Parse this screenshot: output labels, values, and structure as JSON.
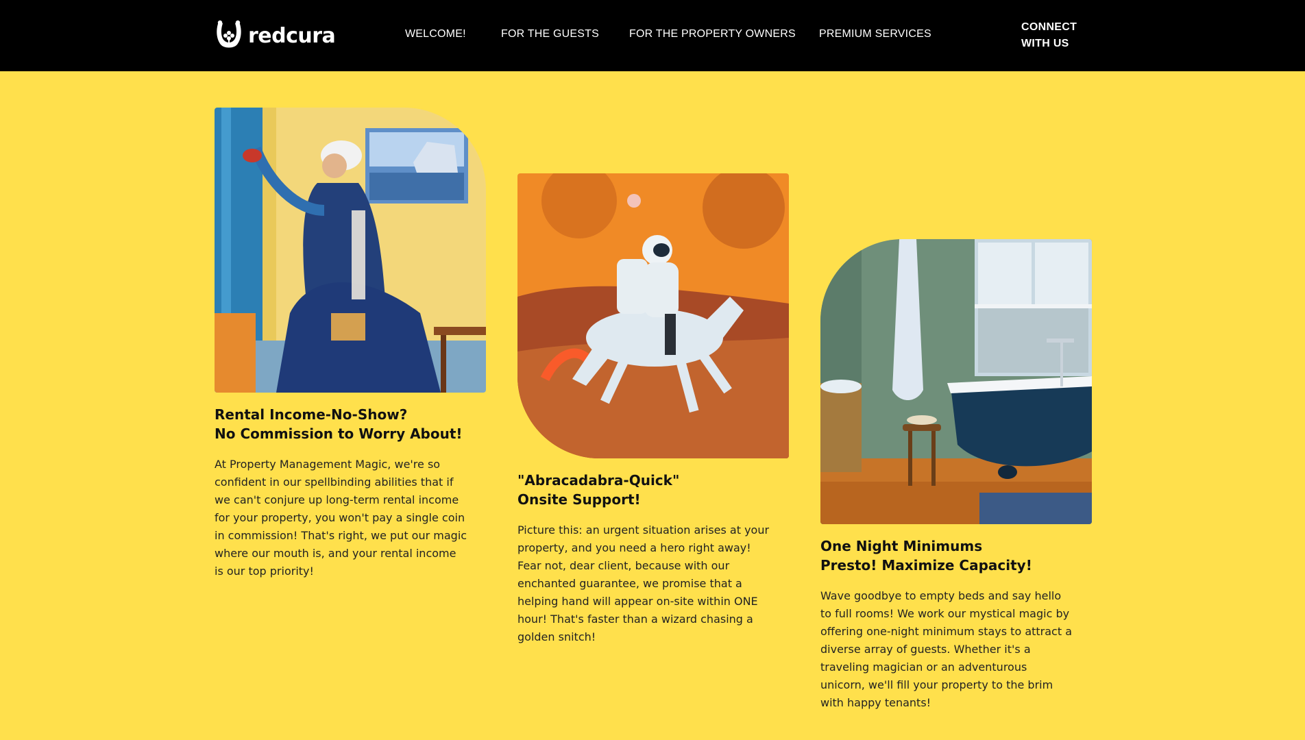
{
  "brand": {
    "name": "redcura",
    "logo_icon": "horseshoe-clover-icon"
  },
  "nav": {
    "items": [
      {
        "label": "WELCOME!"
      },
      {
        "label": "FOR THE GUESTS"
      },
      {
        "label": "FOR THE PROPERTY OWNERS"
      },
      {
        "label": "PREMIUM SERVICES"
      }
    ],
    "connect_line1": "CONNECT",
    "connect_line2": "WITH US"
  },
  "colors": {
    "background": "#ffe04c",
    "header": "#000000"
  },
  "cards": [
    {
      "image": "maid-cleaning-painting",
      "title_line1": "Rental Income-No-Show?",
      "title_line2": "No Commission to Worry About!",
      "body": "At Property Management Magic, we're so confident in our spellbinding abilities that if we can't conjure up long-term rental income for your property, you won't pay a single coin in commission! That's right, we put our magic where our mouth is, and your rental income is our top priority!"
    },
    {
      "image": "astronaut-riding-horse-on-mars",
      "title_line1": "\"Abracadabra-Quick\"",
      "title_line2": "Onsite Support!",
      "body": "Picture this: an urgent situation arises at your property, and you need a hero right away! Fear not, dear client, because with our enchanted guarantee, we promise that a helping hand will appear on-site within ONE hour! That's faster than a wizard chasing a golden snitch!"
    },
    {
      "image": "bathroom-clawfoot-tub-painting",
      "title_line1": "One Night Minimums",
      "title_line2": "Presto! Maximize Capacity!",
      "body": "Wave goodbye to empty beds and say hello to full rooms! We work our mystical magic by offering one-night minimum stays to attract a diverse array of guests. Whether it's a traveling magician or an adventurous unicorn, we'll fill your property to the brim with happy tenants!"
    }
  ]
}
